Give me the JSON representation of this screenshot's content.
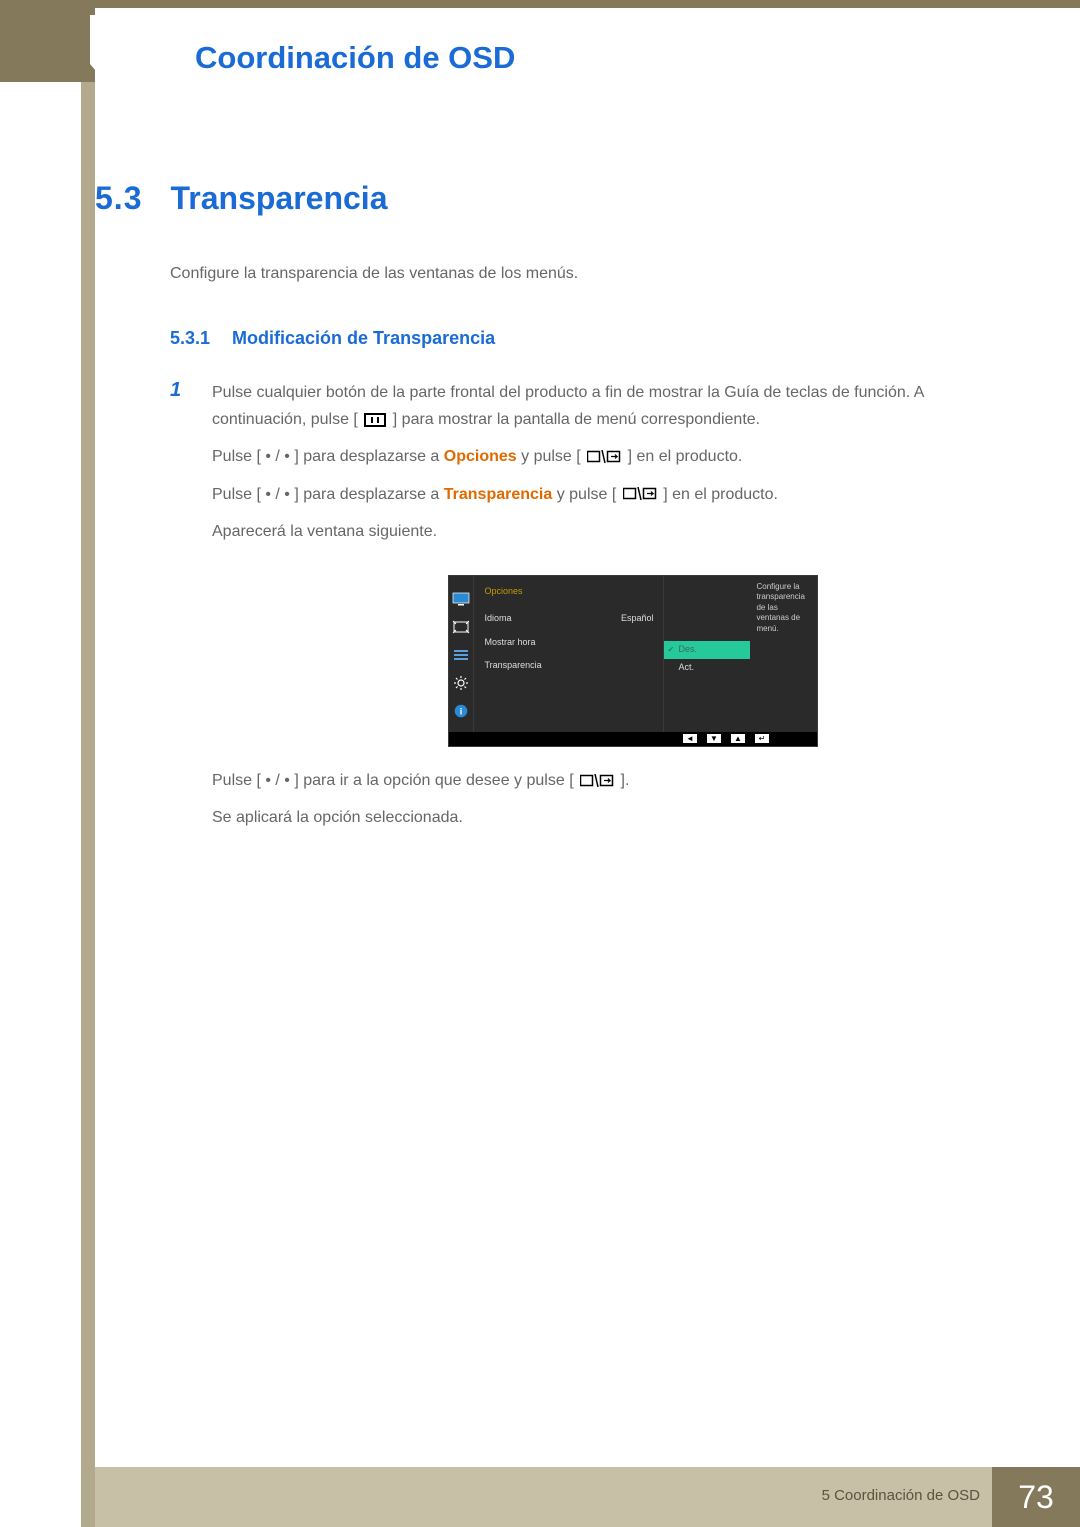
{
  "header": {
    "title": "Coordinación de OSD"
  },
  "section": {
    "number": "5.3",
    "title": "Transparencia",
    "intro": "Configure la transparencia de las ventanas de los menús."
  },
  "subsection": {
    "number": "5.3.1",
    "title": "Modificación de Transparencia"
  },
  "steps": {
    "s1": {
      "num": "1",
      "p1a": "Pulse cualquier botón de la parte frontal del producto a fin de mostrar la Guía de teclas de función. A continuación, pulse [",
      "p1b": "] para mostrar la pantalla de menú correspondiente.",
      "p2a": "Pulse [ • / • ] para desplazarse a ",
      "p2hl1": "Opciones",
      "p2b": " y pulse [",
      "p2c": "] en el producto.",
      "p3a": "Pulse [ • / • ] para desplazarse a ",
      "p3hl2": "Transparencia",
      "p3b": " y pulse [",
      "p3c": "] en el producto.",
      "p4": "Aparecerá la ventana siguiente.",
      "p5a": "Pulse [ • / • ] para ir a la opción que desee y pulse [",
      "p5b": "].",
      "p6": "Se aplicará la opción seleccionada."
    }
  },
  "osd": {
    "category": "Opciones",
    "rows": {
      "idioma_label": "Idioma",
      "idioma_value": "Español",
      "mostrar": "Mostrar hora",
      "transparencia": "Transparencia"
    },
    "options": {
      "des": "Des.",
      "act": "Act."
    },
    "desc": "Configure la transparencia de las ventanas de menú.",
    "controls": {
      "left": "◄",
      "down": "▼",
      "up": "▲",
      "enter": "↵"
    }
  },
  "footer": {
    "label": "5 Coordinación de OSD",
    "page": "73"
  }
}
